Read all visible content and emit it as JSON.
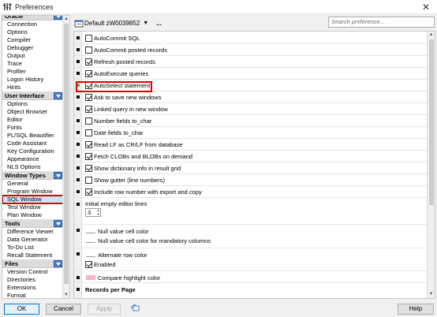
{
  "window": {
    "title": "Preferences",
    "close_glyph": "✕"
  },
  "left_panel": {
    "groups": [
      {
        "label": "Oracle",
        "items": [
          "Connection",
          "Options",
          "Compiler",
          "Debugger",
          "Output",
          "Trace",
          "Profiler",
          "Logon History",
          "Hints"
        ]
      },
      {
        "label": "User Interface",
        "items": [
          "Options",
          "Object Browser",
          "Editor",
          "Fonts",
          "PL/SQL Beautifier",
          "Code Assistant",
          "Key Configuration",
          "Appearance",
          "NLS Options"
        ]
      },
      {
        "label": "Window Types",
        "items": [
          "General",
          "Program Window",
          "SQL Window",
          "Test Window",
          "Plan Window"
        ]
      },
      {
        "label": "Tools",
        "items": [
          "Difference Viewer",
          "Data Generator",
          "To-Do List",
          "Recall Statement"
        ]
      },
      {
        "label": "Files",
        "items": [
          "Version Control",
          "Directories",
          "Extensions",
          "Format"
        ]
      }
    ],
    "selected_item": "SQL Window"
  },
  "toolbar": {
    "profile": "Default zW0039852",
    "more_label": "...",
    "search_placeholder": "Search preference..."
  },
  "options": [
    {
      "label": "AutoCommit SQL",
      "checked": false
    },
    {
      "label": "AutoCommit posted records",
      "checked": false
    },
    {
      "label": "Refresh posted records",
      "checked": true
    },
    {
      "label": "AutoExecute queries",
      "checked": true
    },
    {
      "label": "AutoSelect statement",
      "checked": true
    },
    {
      "label": "Ask to save new windows",
      "checked": true
    },
    {
      "label": "Linked query in new window",
      "checked": true
    },
    {
      "label": "Number fields to_char",
      "checked": false
    },
    {
      "label": "Date fields to_char",
      "checked": false
    },
    {
      "label": "Read LF as CR/LF from database",
      "checked": true
    },
    {
      "label": "Fetch CLOBs and BLOBs on demand",
      "checked": true
    },
    {
      "label": "Show dictionary info in result grid",
      "checked": true
    },
    {
      "label": "Show gutter (line numbers)",
      "checked": false
    },
    {
      "label": "Include row number with export and copy",
      "checked": true
    }
  ],
  "empty_editor_lines": {
    "label": "Initial empty editor lines",
    "value": "3"
  },
  "colors": {
    "null_value": "Null value cell color",
    "null_value_mandatory": "Null value cell color for mandatory columns",
    "alternate_row": "Alternate row color",
    "alternate_enabled": "Enabled",
    "compare_highlight": "Compare highlight color",
    "compare_swatch": "#f7b3c2"
  },
  "records_per_page": {
    "label": "Records per Page"
  },
  "buttons": {
    "ok": "OK",
    "cancel": "Cancel",
    "apply": "Apply",
    "help": "Help"
  },
  "accent": {
    "selection_highlight": "#e00000",
    "group_button": "#4a7fc9"
  }
}
